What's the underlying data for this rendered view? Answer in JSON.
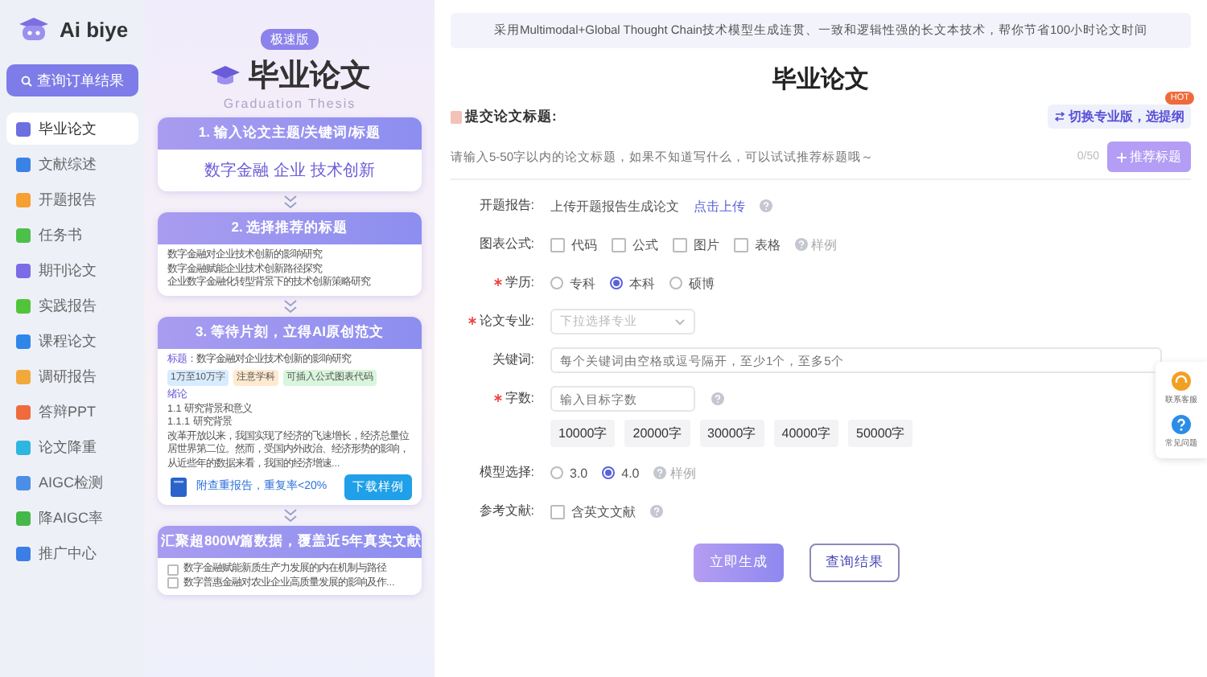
{
  "brand": {
    "name": "Ai biye"
  },
  "sidebar": {
    "search_button": "查询订单结果",
    "items": [
      {
        "label": "毕业论文",
        "selected": true,
        "color": "#6b6fe0"
      },
      {
        "label": "文献综述",
        "selected": false,
        "color": "#3b82e6"
      },
      {
        "label": "开题报告",
        "selected": false,
        "color": "#f5a031"
      },
      {
        "label": "任务书",
        "selected": false,
        "color": "#4cc04a"
      },
      {
        "label": "期刊论文",
        "selected": false,
        "color": "#7b6be6"
      },
      {
        "label": "实践报告",
        "selected": false,
        "color": "#52c43a"
      },
      {
        "label": "课程论文",
        "selected": false,
        "color": "#2f86e8"
      },
      {
        "label": "调研报告",
        "selected": false,
        "color": "#f2a83a"
      },
      {
        "label": "答辩PPT",
        "selected": false,
        "color": "#ef6a3c"
      },
      {
        "label": "论文降重",
        "selected": false,
        "color": "#2db6e0"
      },
      {
        "label": "AIGC检测",
        "selected": false,
        "color": "#4a8ee8"
      },
      {
        "label": "降AIGC率",
        "selected": false,
        "color": "#45b84a"
      },
      {
        "label": "推广中心",
        "selected": false,
        "color": "#3a7ee6"
      }
    ]
  },
  "promo": {
    "badge": "极速版",
    "title": "毕业论文",
    "subtitle": "Graduation Thesis",
    "steps": [
      {
        "kind": "keywords",
        "heading": "1. 输入论文主题/关键词/标题",
        "text": "数字金融 企业 技术创新"
      },
      {
        "kind": "titles",
        "heading": "2. 选择推荐的标题",
        "lines": [
          "数字金融对企业技术创新的影响研究",
          "数字金融赋能企业技术创新路径探究",
          "企业数字金融化转型背景下的技术创新策略研究"
        ]
      },
      {
        "kind": "sample",
        "heading": "3. 等待片刻，立得AI原创范文",
        "title_label": "标题：",
        "title": "数字金融对企业技术创新的影响研究",
        "tags": [
          {
            "label": "1万至10万字",
            "color": "#d8ebff"
          },
          {
            "label": "注意学科",
            "color": "#ffe9cf"
          },
          {
            "label": "可插入公式图表代码",
            "color": "#d9f5dc"
          }
        ],
        "lines": [
          "绪论",
          "1.1 研究背景和意义",
          "1.1.1 研究背景"
        ],
        "paragraph": "改革开放以来，我国实现了经济的飞速增长，经济总量位居世界第二位。然而，受国内外政治、经济形势的影响，从近些年的数据来看，我国的经济增速...",
        "report": "附查重报告，重复率<20%",
        "download": "下载样例"
      },
      {
        "kind": "references",
        "heading": "汇聚超800W篇数据，覆盖近5年真实文献",
        "items": [
          {
            "label": "数字金融赋能新质生产力发展的内在机制与路径",
            "checked": false
          },
          {
            "label": "数字普惠金融对农业企业高质量发展的影响及作...",
            "checked": false
          }
        ]
      }
    ]
  },
  "main": {
    "banner": "采用Multimodal+Global Thought Chain技术模型生成连贯、一致和逻辑性强的长文本技术，帮你节省100小时论文时间",
    "title": "毕业论文",
    "title_field": {
      "label": "提交论文标题:",
      "switch_link": "切换专业版，选提纲",
      "hot_badge": "HOT",
      "placeholder": "请输入5-50字以内的论文标题，如果不知道写什么，可以试试推荐标题哦～",
      "count": "0/50",
      "recommend_button": "推荐标题"
    },
    "rows": [
      {
        "kind": "upload",
        "label": "开题报告:",
        "required": false,
        "text": "上传开题报告生成论文",
        "link": "点击上传",
        "help": true
      },
      {
        "kind": "checks",
        "label": "图表公式:",
        "required": false,
        "options": [
          {
            "label": "代码",
            "checked": false
          },
          {
            "label": "公式",
            "checked": false
          },
          {
            "label": "图片",
            "checked": false
          },
          {
            "label": "表格",
            "checked": false
          }
        ],
        "sample": "样例"
      },
      {
        "kind": "radios",
        "label": "学历:",
        "required": true,
        "options": [
          {
            "label": "专科",
            "selected": false
          },
          {
            "label": "本科",
            "selected": true
          },
          {
            "label": "硕博",
            "selected": false
          }
        ]
      },
      {
        "kind": "select",
        "label": "论文专业:",
        "required": true,
        "placeholder": "下拉选择专业"
      },
      {
        "kind": "text",
        "label": "关键词:",
        "required": false,
        "placeholder": "每个关键词由空格或逗号隔开，至少1个，至多5个"
      },
      {
        "kind": "words",
        "label": "字数:",
        "required": true,
        "placeholder": "输入目标字数",
        "help": true,
        "chips": [
          "10000字",
          "20000字",
          "30000字",
          "40000字",
          "50000字"
        ]
      },
      {
        "kind": "radios",
        "label": "模型选择:",
        "required": false,
        "options": [
          {
            "label": "3.0",
            "selected": false
          },
          {
            "label": "4.0",
            "selected": true
          }
        ],
        "sample": "样例"
      },
      {
        "kind": "checks",
        "label": "参考文献:",
        "required": false,
        "options": [
          {
            "label": "含英文文献",
            "checked": false
          }
        ],
        "help": true
      }
    ],
    "buttons": [
      {
        "label": "立即生成",
        "kind": "primary"
      },
      {
        "label": "查询结果",
        "kind": "secondary"
      }
    ]
  },
  "float": [
    {
      "kind": "service",
      "label": "联系客服"
    },
    {
      "kind": "help",
      "label": "常见问题"
    }
  ]
}
